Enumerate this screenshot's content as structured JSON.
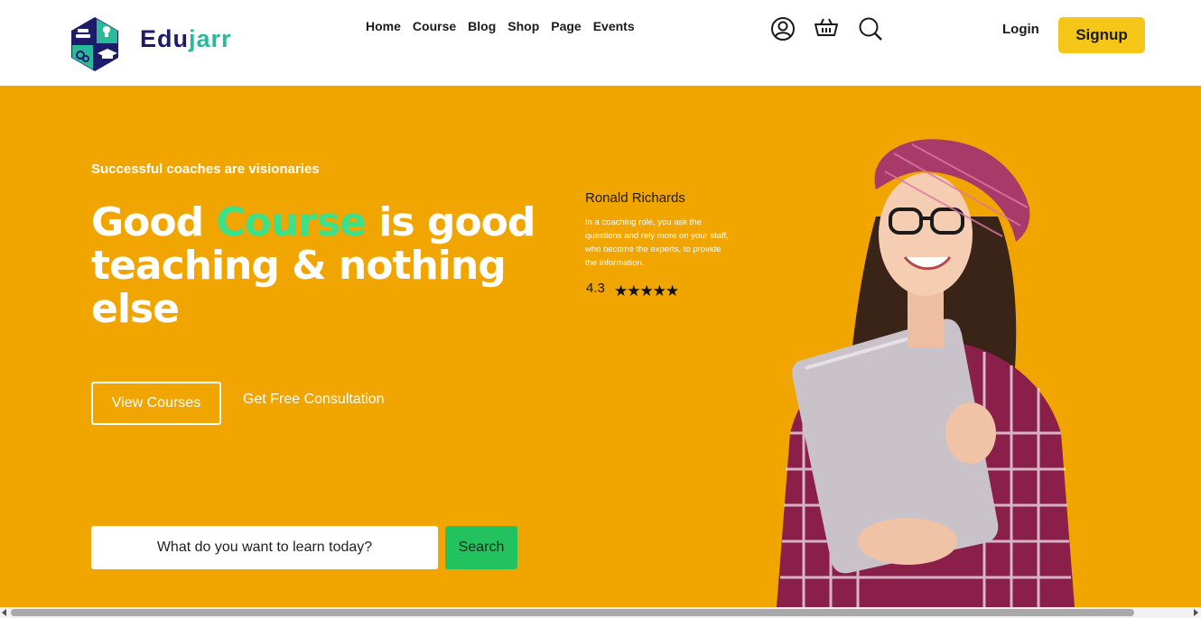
{
  "brand": {
    "name_part1": "Edu",
    "name_part2": "jarr",
    "logo_icon": "hexagon-education-logo"
  },
  "nav": {
    "items": [
      "Home",
      "Course",
      "Blog",
      "Shop",
      "Page",
      "Events"
    ]
  },
  "header_icons": [
    "user-icon",
    "basket-icon",
    "search-icon"
  ],
  "auth": {
    "login_label": "Login",
    "signup_label": "Signup"
  },
  "hero": {
    "tagline": "Successful coaches are visionaries",
    "headline_part1": "Good ",
    "headline_highlight": "Course",
    "headline_part2": " is good teaching & nothing else",
    "view_courses_label": "View Courses",
    "consultation_label": "Get Free Consultation",
    "search_placeholder": "What do you want to learn today?",
    "search_button_label": "Search"
  },
  "review": {
    "name": "Ronald Richards",
    "text": "In a coaching role, you ask the questions and rely more on your staff, who become the experts, to provide the information.",
    "rating": "4.3",
    "stars": 5
  },
  "colors": {
    "hero_bg": "#f0a500",
    "accent_green": "#3de089",
    "signup_yellow": "#f5c518",
    "search_green": "#22c35e",
    "brand_navy": "#1e1b6b"
  }
}
